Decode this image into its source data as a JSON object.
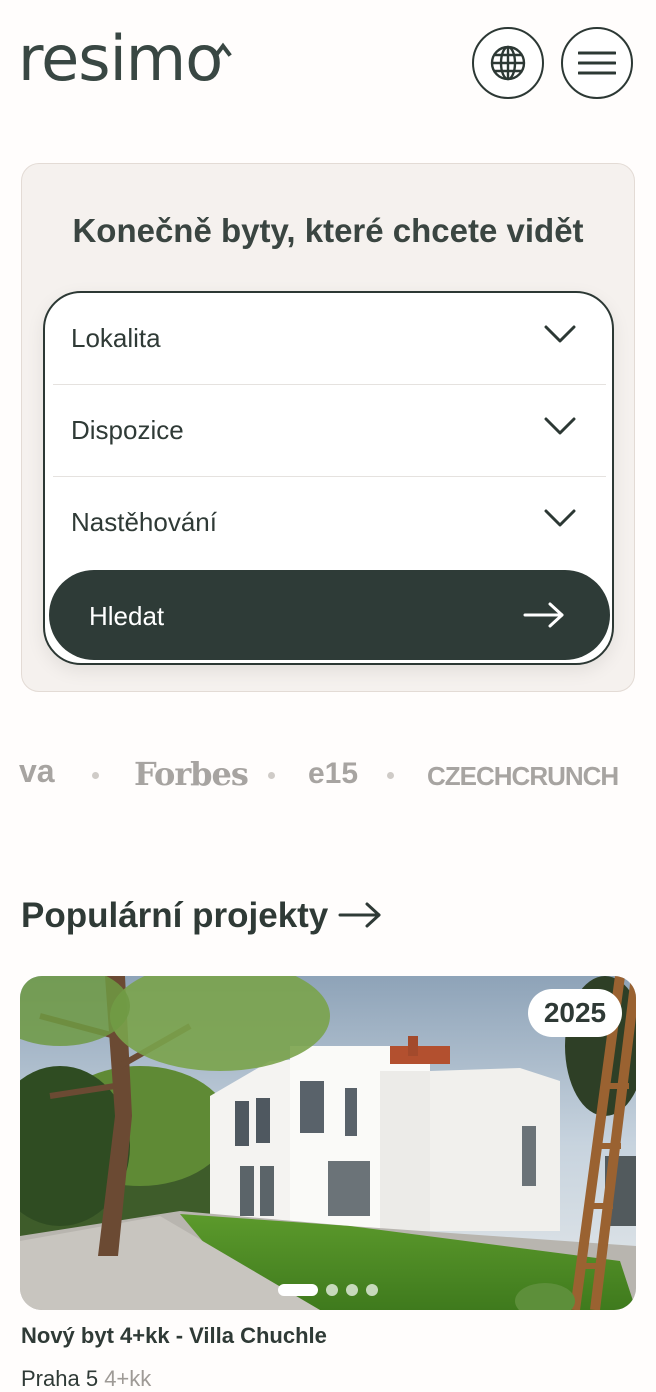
{
  "header": {
    "logo_text": "resimo",
    "globe_icon": "globe-icon",
    "menu_icon": "hamburger-menu-icon"
  },
  "search": {
    "title": "Konečně byty, které chcete vidět",
    "filters": [
      {
        "label": "Lokalita",
        "icon": "chevron-down-icon"
      },
      {
        "label": "Dispozice",
        "icon": "chevron-down-icon"
      },
      {
        "label": "Nastěhování",
        "icon": "chevron-down-icon"
      }
    ],
    "button_label": "Hledat",
    "button_icon": "arrow-right-icon"
  },
  "press": {
    "logos": [
      "va",
      "Forbes",
      "e15",
      "CZECHCRUNCH"
    ]
  },
  "popular": {
    "title": "Populární projekty",
    "title_icon": "arrow-right-icon",
    "project": {
      "year": "2025",
      "name": "Nový byt 4+kk - Villa Chuchle",
      "location": "Praha 5",
      "layout": "4+kk",
      "slides_total": 4,
      "active_slide": 1
    }
  },
  "colors": {
    "primary_dark": "#2e3b37",
    "card_bg": "#f5f1ee",
    "page_bg": "#fffdfc",
    "muted_text": "#a7a4a1"
  }
}
